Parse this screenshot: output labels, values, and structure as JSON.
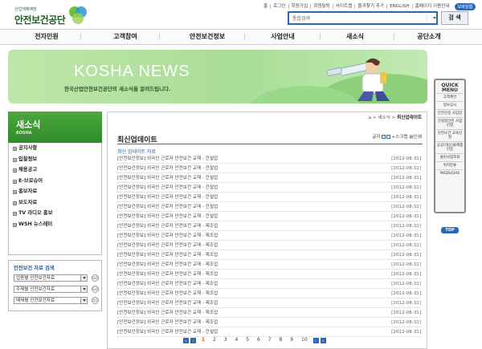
{
  "header": {
    "logo_sub": "산업재해예방",
    "logo_name": "안전보건공단",
    "util_links": [
      "홈",
      "로그인",
      "회원가입",
      "회원탈퇴",
      "사이트맵",
      "즐겨찾기 추가",
      "ENGLISH",
      "홈페이지 이용안내"
    ],
    "mobile_label": "모바일웹",
    "search_select": "통합검색",
    "search_button": "검 색"
  },
  "nav": {
    "items": [
      "전자민원",
      "고객참여",
      "안전보건정보",
      "사업안내",
      "새소식",
      "공단소개"
    ]
  },
  "banner": {
    "title": "KOSHA NEWS",
    "desc": "한국산업안전보건공단의 새소식을 알려드립니다."
  },
  "quick_menu": {
    "title": "QUICK MENU",
    "items": [
      "고객제안",
      "정보공시",
      "안전인증 사업장",
      "건설업안전 사업신청",
      "안전보건 교육신청",
      "공공(대상)물제품인증",
      "클린사업조회",
      "위치분류",
      "MSDS/GHS"
    ],
    "top_label": "TOP"
  },
  "lnb": {
    "title": "새소식",
    "subtitle": "KOSHA",
    "items": [
      "공지사항",
      "입찰정보",
      "채용공고",
      "E-브로슈어",
      "홍보자료",
      "보도자료",
      "TV 라디오 홍보",
      "WSH 뉴스레터"
    ]
  },
  "search_box": {
    "title": "안전보건 자료 검색",
    "rows": [
      "업종별 안전보건자료",
      "주제별 안전보건자료",
      "매체별 안전보건자료"
    ],
    "go_label": "GO"
  },
  "content": {
    "location": [
      "새소식",
      "최신업데이트"
    ],
    "title": "최신업데이트",
    "tools": [
      "글자",
      "스크랩",
      "인쇄"
    ],
    "subtitle": "최신 업데이트 자료",
    "rows": [
      {
        "text": "[안전보건정보] 외국인 근로자 안전보건 교재 - 건설업",
        "date": "[2012-08-31]"
      },
      {
        "text": "[안전보건정보] 외국인 근로자 안전보건 교재 - 건설업",
        "date": "[2012-08-31]"
      },
      {
        "text": "[안전보건정보] 외국인 근로자 안전보건 교재 - 건설업",
        "date": "[2012-08-31]"
      },
      {
        "text": "[안전보건정보] 외국인 근로자 안전보건 교재 - 건설업",
        "date": "[2012-08-31]"
      },
      {
        "text": "[안전보건정보] 외국인 근로자 안전보건 교재 - 건설업",
        "date": "[2012-08-31]"
      },
      {
        "text": "[안전보건정보] 외국인 근로자 안전보건 교재 - 건설업",
        "date": "[2012-08-31]"
      },
      {
        "text": "[안전보건정보] 외국인 근로자 안전보건 교재 - 건설업",
        "date": "[2012-08-31]"
      },
      {
        "text": "[안전보건정보] 외국인 근로자 안전보건 교재 - 제조업",
        "date": "[2012-08-31]"
      },
      {
        "text": "[안전보건정보] 외국인 근로자 안전보건 교재 - 제조업",
        "date": "[2012-08-31]"
      },
      {
        "text": "[안전보건정보] 외국인 근로자 안전보건 교재 - 제조업",
        "date": "[2012-08-31]"
      },
      {
        "text": "[안전보건정보] 외국인 근로자 안전보건 교재 - 제조업",
        "date": "[2012-08-31]"
      },
      {
        "text": "[안전보건정보] 외국인 근로자 안전보건 교재 - 제조업",
        "date": "[2012-08-31]"
      },
      {
        "text": "[안전보건정보] 외국인 근로자 안전보건 교재 - 제조업",
        "date": "[2012-08-31]"
      },
      {
        "text": "[안전보건정보] 외국인 근로자 안전보건 교재 - 제조업",
        "date": "[2012-08-31]"
      },
      {
        "text": "[안전보건정보] 외국인 근로자 안전보건 교재 - 제조업",
        "date": "[2012-08-31]"
      },
      {
        "text": "[안전보건정보] 외국인 근로자 안전보건 교재 - 제조업",
        "date": "[2012-08-31]"
      },
      {
        "text": "[안전보건정보] 외국인 근로자 안전보건 교재 - 제조업",
        "date": "[2012-08-31]"
      },
      {
        "text": "[안전보건정보] 외국인 근로자 안전보건 교재 - 제조업",
        "date": "[2012-08-31]"
      },
      {
        "text": "[안전보건정보] 외국인 근로자 안전보건 교재 - 건설업",
        "date": "[2012-08-31]"
      }
    ],
    "pages": [
      "1",
      "2",
      "3",
      "4",
      "5",
      "6",
      "7",
      "8",
      "9",
      "10"
    ],
    "current_page": "1"
  },
  "colors": {
    "brand_green": "#2f8c2a",
    "brand_blue": "#2a69b8",
    "banner_green": "#a9dd98"
  }
}
